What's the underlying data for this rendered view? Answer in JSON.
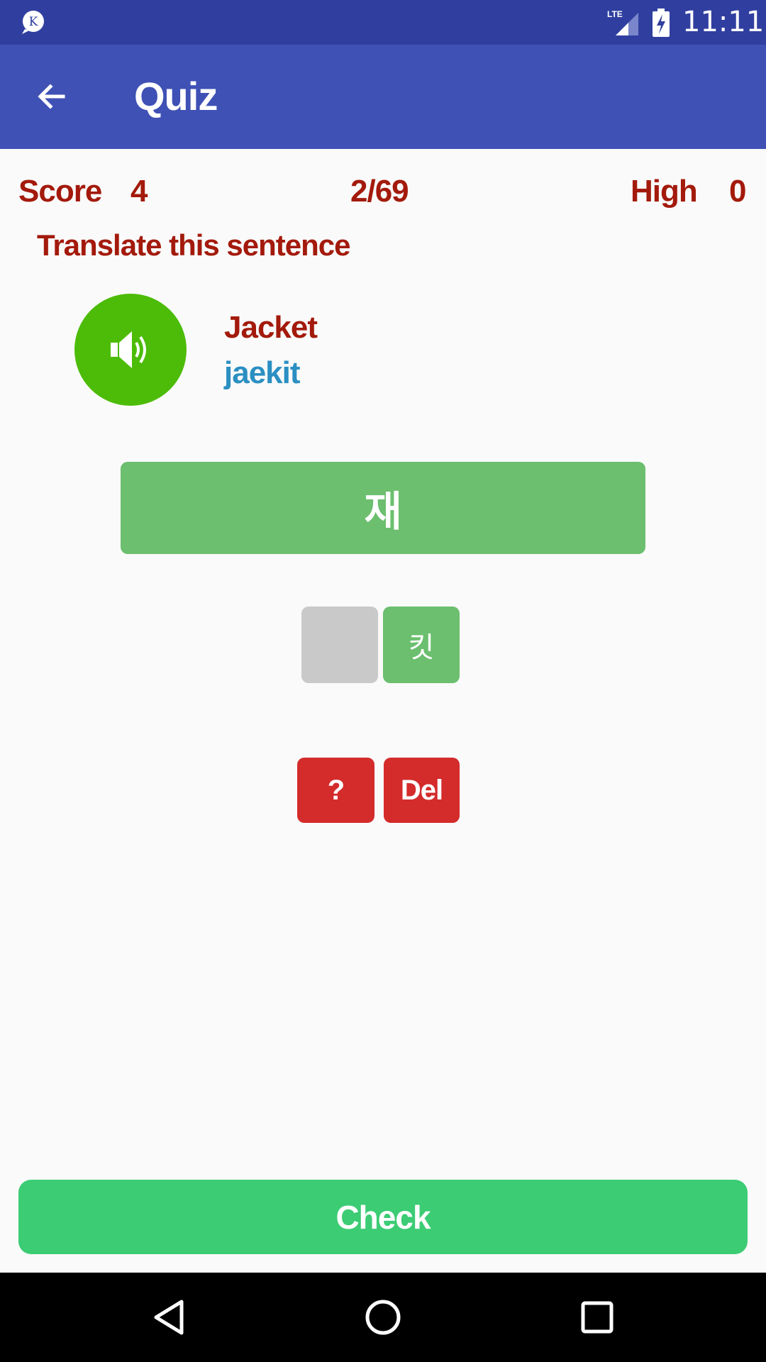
{
  "status_bar": {
    "network": "LTE",
    "time": "11:11",
    "app_icon_letter": "K"
  },
  "app_bar": {
    "title": "Quiz",
    "back_icon": "arrow-back-icon"
  },
  "quiz": {
    "score_label": "Score",
    "score_value": "4",
    "progress": "2/69",
    "high_label": "High",
    "high_value": "0",
    "instruction": "Translate this sentence",
    "word_english": "Jacket",
    "word_romanized": "jaekit",
    "answer_text": "재",
    "tiles": [
      "",
      "킷"
    ],
    "hint_label": "?",
    "delete_label": "Del",
    "check_label": "Check"
  },
  "colors": {
    "status_bar": "#303f9f",
    "app_bar": "#3f51b5",
    "text_red": "#a31a0c",
    "text_blue": "#2b8fc2",
    "speaker": "#4cbc08",
    "answer_green": "#6bbf6e",
    "tile_grey": "#c9c9c9",
    "button_red": "#d42b2b",
    "check_green": "#3ccc74"
  }
}
